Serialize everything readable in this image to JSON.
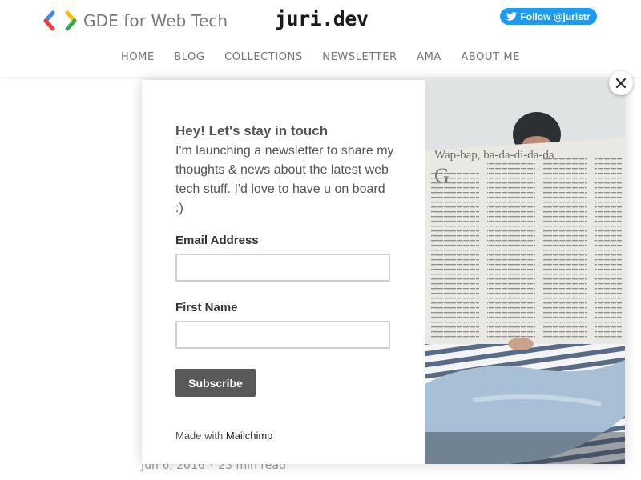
{
  "header": {
    "gde_text": "GDE for Web Tech",
    "brand": "juri.dev",
    "follow_label": "Follow @juristr",
    "nav": [
      "HOME",
      "BLOG",
      "COLLECTIONS",
      "NEWSLETTER",
      "AMA",
      "ABOUT ME"
    ]
  },
  "article": {
    "date": "Jun 6, 2016",
    "separator": "·",
    "read_time": "23 min read"
  },
  "modal": {
    "title": "Hey! Let's stay in touch",
    "description": "I'm launching a newsletter to share my thoughts & news about the latest web tech stuff. I'd love to have u on board :)",
    "email_label": "Email Address",
    "email_value": "",
    "first_name_label": "First Name",
    "first_name_value": "",
    "subscribe_label": "Subscribe",
    "made_with": "Made with",
    "mailchimp": "Mailchimp",
    "newspaper_headline": "Wap-bap, ba-da-di-da-da"
  },
  "colors": {
    "twitter": "#1d9bf0",
    "button": "#595959"
  },
  "icons": [
    "gde-logo-icon",
    "twitter-bird-icon",
    "close-icon"
  ]
}
